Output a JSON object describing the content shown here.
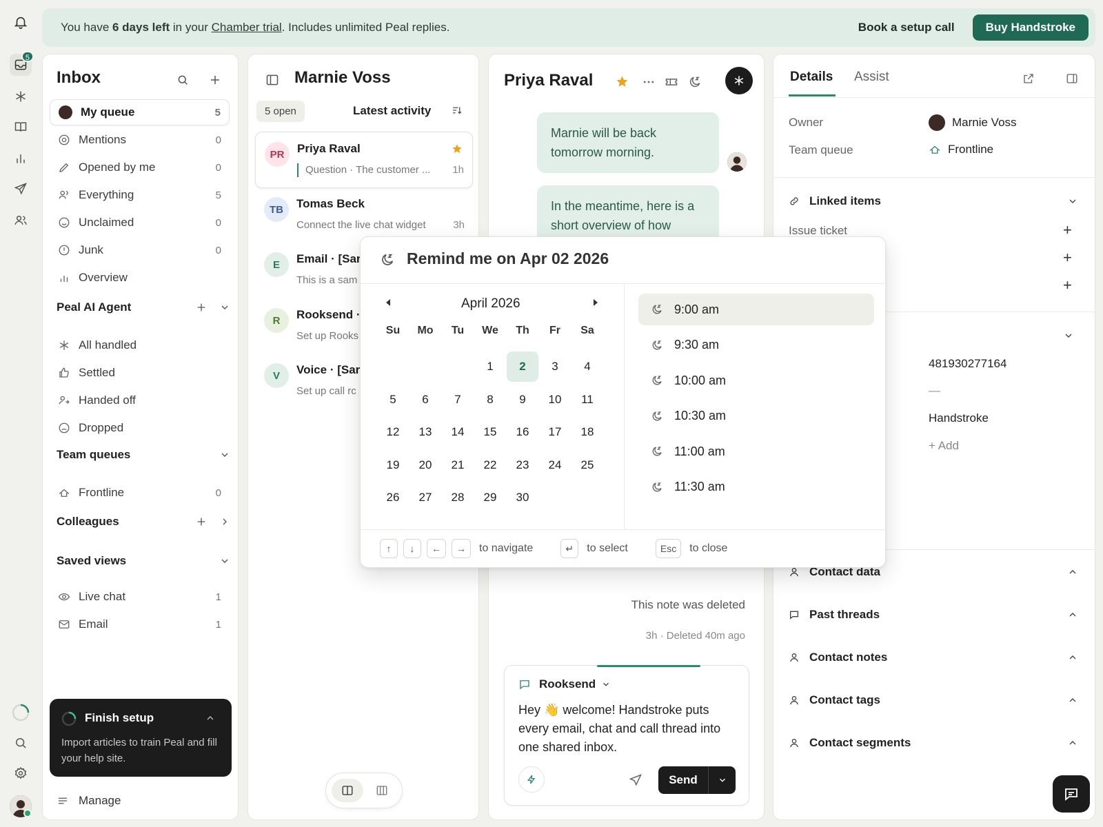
{
  "rail": {
    "inbox_badge": "5"
  },
  "banner": {
    "prefix": "You have ",
    "days": "6 days left",
    "mid": " in your ",
    "trial_link": "Chamber trial",
    "suffix": ". Includes unlimited Peal replies.",
    "book_label": "Book a setup call",
    "buy_label": "Buy Handstroke"
  },
  "nav": {
    "title": "Inbox",
    "items": [
      {
        "label": "My queue",
        "count": "5",
        "icon": "avatar"
      },
      {
        "label": "Mentions",
        "count": "0",
        "icon": "at-icon"
      },
      {
        "label": "Opened by me",
        "count": "0",
        "icon": "pencil-icon"
      },
      {
        "label": "Everything",
        "count": "5",
        "icon": "users-icon"
      },
      {
        "label": "Unclaimed",
        "count": "0",
        "icon": "smile-icon"
      },
      {
        "label": "Junk",
        "count": "0",
        "icon": "alert-icon"
      },
      {
        "label": "Overview",
        "count": "",
        "icon": "bars-icon"
      }
    ],
    "peal_section": "Peal AI Agent",
    "peal_items": [
      {
        "label": "All handled",
        "icon": "asterisk-icon"
      },
      {
        "label": "Settled",
        "icon": "thumbs-up-icon"
      },
      {
        "label": "Handed off",
        "icon": "handoff-icon"
      },
      {
        "label": "Dropped",
        "icon": "frown-icon"
      }
    ],
    "team_section": "Team queues",
    "team_items": [
      {
        "label": "Frontline",
        "count": "0"
      }
    ],
    "colleagues_section": "Colleagues",
    "saved_section": "Saved views",
    "saved_items": [
      {
        "label": "Live chat",
        "count": "1",
        "icon": "eye-icon"
      },
      {
        "label": "Email",
        "count": "1",
        "icon": "mail-icon"
      }
    ],
    "setup": {
      "title": "Finish setup",
      "body": "Import articles to train Peal and fill your help site."
    },
    "manage_label": "Manage"
  },
  "list": {
    "title": "Marnie Voss",
    "open_chip": "5 open",
    "sort_label": "Latest activity",
    "items": [
      {
        "initials": "PR",
        "name": "Priya Raval",
        "sub": "Question · The customer ...",
        "time": "1h",
        "starred": true
      },
      {
        "initials": "TB",
        "name": "Tomas Beck",
        "sub": "Connect the live chat widget",
        "time": "3h"
      },
      {
        "initials": "E",
        "name": "Email · [Sar",
        "sub": "This is a sam"
      },
      {
        "initials": "R",
        "name": "Rooksend ·",
        "sub": "Set up Rooks"
      },
      {
        "initials": "V",
        "name": "Voice · [Sar",
        "sub": "Set up call rc"
      }
    ]
  },
  "conv": {
    "title": "Priya Raval",
    "bubble1": "Marnie will be back tomorrow morning.",
    "bubble2": "In the meantime, here is a short overview of how",
    "deleted_note": "This note was deleted",
    "deleted_meta": "3h · Deleted 40m ago",
    "composer": {
      "channel": "Rooksend",
      "text": "Hey 👋 welcome! Handstroke puts every email, chat and call thread into one shared inbox.",
      "send_label": "Send"
    }
  },
  "reminder": {
    "title": "Remind me on Apr 02 2026",
    "month_label": "April 2026",
    "weekdays": [
      "Su",
      "Mo",
      "Tu",
      "We",
      "Th",
      "Fr",
      "Sa"
    ],
    "first_weekday": 3,
    "days_in_month": 30,
    "selected_day": 2,
    "times": [
      "9:00 am",
      "9:30 am",
      "10:00 am",
      "10:30 am",
      "11:00 am",
      "11:30 am"
    ],
    "selected_time": "9:00 am",
    "hints": {
      "navigate": "to navigate",
      "select": "to select",
      "close_key": "Esc",
      "close": "to close"
    }
  },
  "details": {
    "tab_details": "Details",
    "tab_assist": "Assist",
    "owner_label": "Owner",
    "owner_value": "Marnie Voss",
    "queue_label": "Team queue",
    "queue_value": "Frontline",
    "linked_title": "Linked items",
    "issue_ticket": "Issue ticket",
    "id_value": "481930277164",
    "dash_value": "—",
    "company_value": "Handstroke",
    "add_label": "+ Add",
    "sections": [
      "Contact data",
      "Past threads",
      "Contact notes",
      "Contact tags",
      "Contact segments"
    ]
  }
}
